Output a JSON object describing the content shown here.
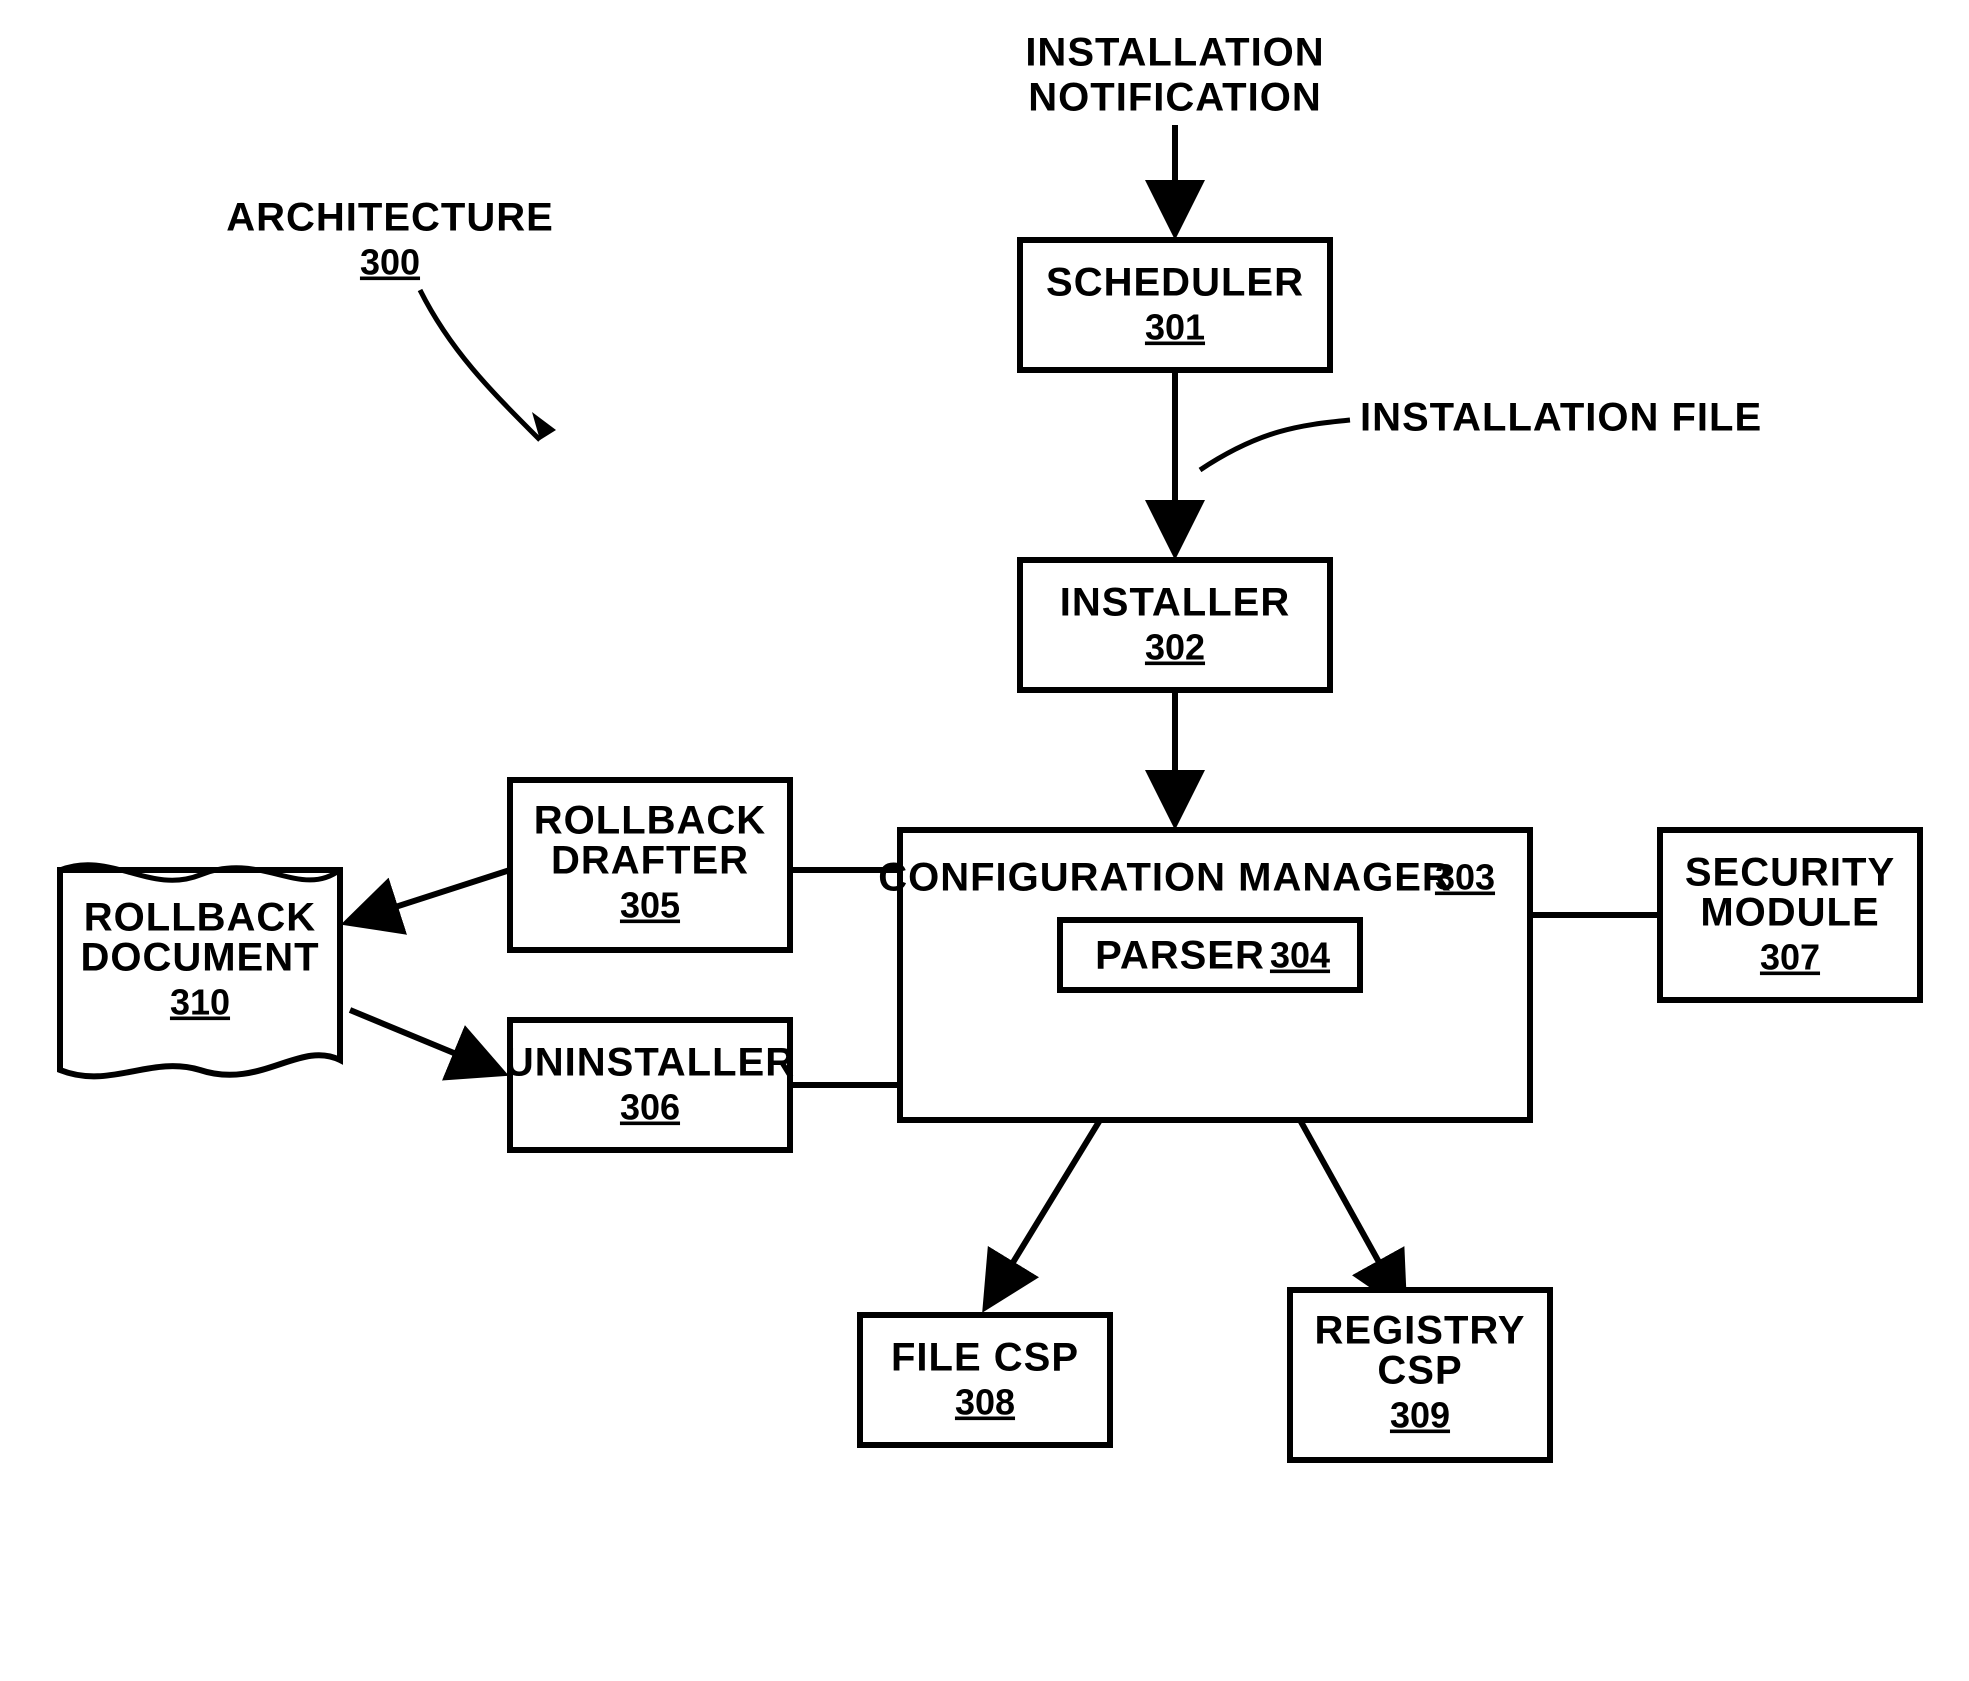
{
  "diagram_title": {
    "label": "ARCHITECTURE",
    "num": "300"
  },
  "input_label": {
    "line1": "INSTALLATION",
    "line2": "NOTIFICATION"
  },
  "edge_label": "INSTALLATION FILE",
  "nodes": {
    "scheduler": {
      "label": "SCHEDULER",
      "num": "301"
    },
    "installer": {
      "label": "INSTALLER",
      "num": "302"
    },
    "config_mgr": {
      "label": "CONFIGURATION MANAGER",
      "num": "303"
    },
    "parser": {
      "label": "PARSER",
      "num": "304"
    },
    "rollback_drafter": {
      "line1": "ROLLBACK",
      "line2": "DRAFTER",
      "num": "305"
    },
    "uninstaller": {
      "label": "UNINSTALLER",
      "num": "306"
    },
    "security_module": {
      "line1": "SECURITY",
      "line2": "MODULE",
      "num": "307"
    },
    "file_csp": {
      "label": "FILE CSP",
      "num": "308"
    },
    "registry_csp": {
      "line1": "REGISTRY",
      "line2": "CSP",
      "num": "309"
    },
    "rollback_doc": {
      "line1": "ROLLBACK",
      "line2": "DOCUMENT",
      "num": "310"
    }
  }
}
